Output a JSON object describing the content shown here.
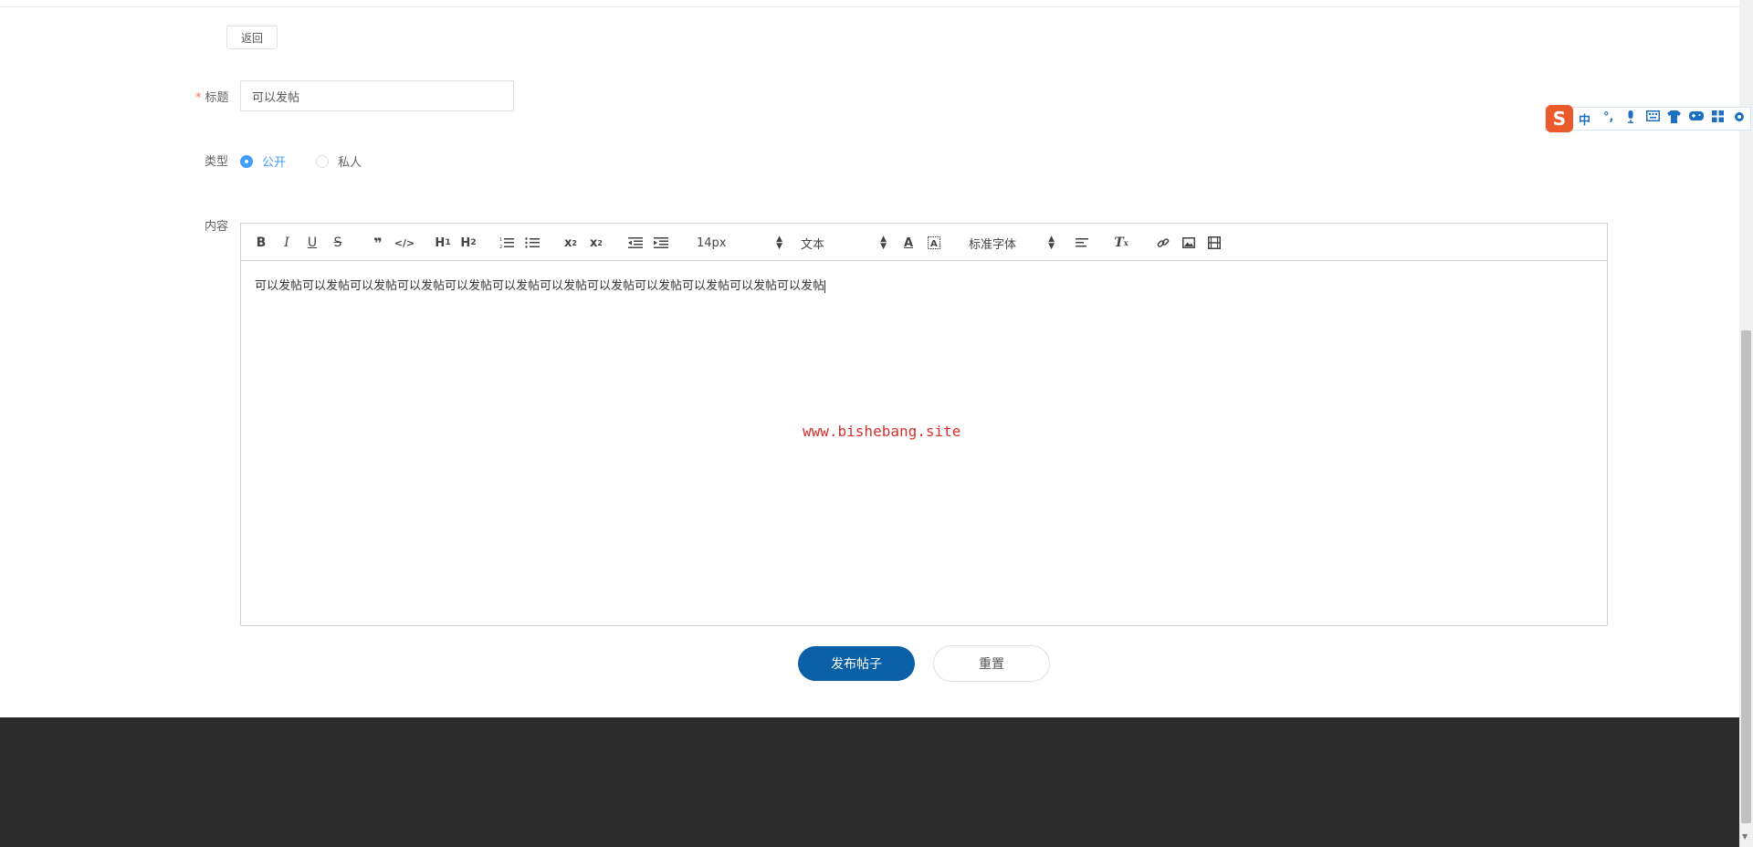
{
  "back_label": "返回",
  "form": {
    "title_label": "标题",
    "title_required_mark": "*",
    "title_value": "可以发帖",
    "type_label": "类型",
    "type_options": [
      {
        "label": "公开",
        "checked": true
      },
      {
        "label": "私人",
        "checked": false
      }
    ],
    "content_label": "内容"
  },
  "editor": {
    "font_size": "14px",
    "header_picker": "文本",
    "font_family": "标准字体",
    "toolbar_icons": [
      "bold-icon",
      "italic-icon",
      "underline-icon",
      "strike-icon",
      "blockquote-icon",
      "code-block-icon",
      "h1-icon",
      "h2-icon",
      "ordered-list-icon",
      "bullet-list-icon",
      "subscript-icon",
      "superscript-icon",
      "outdent-icon",
      "indent-icon",
      "font-color-icon",
      "background-color-icon",
      "align-icon",
      "clear-format-icon",
      "link-icon",
      "image-icon",
      "video-icon"
    ],
    "content": "可以发帖可以发帖可以发帖可以发帖可以发帖可以发帖可以发帖可以发帖可以发帖可以发帖可以发帖可以发帖"
  },
  "watermark": "www.bishebang.site",
  "buttons": {
    "publish": "发布帖子",
    "reset": "重置"
  },
  "ime": {
    "logo": "S",
    "mode": "中"
  },
  "colors": {
    "primary": "#0a5fa6",
    "radio_active": "#409eff",
    "watermark": "#d32f2f",
    "footer": "#2b2b2b"
  }
}
